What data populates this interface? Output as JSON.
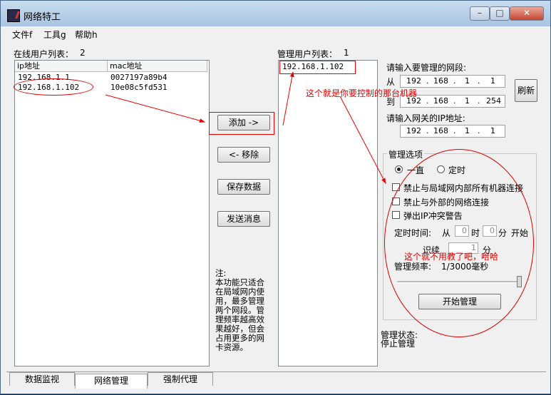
{
  "window": {
    "title": "网络特工"
  },
  "menu": [
    "文件f",
    "工具g",
    "帮助h"
  ],
  "online": {
    "label": "在线用户列表：",
    "count": "2",
    "columns": [
      "ip地址",
      "mac地址"
    ],
    "rows": [
      {
        "ip": "192.168.1.1",
        "mac": "0027197a89b4"
      },
      {
        "ip": "192.168.1.102",
        "mac": "10e08c5fd531"
      }
    ]
  },
  "buttons": {
    "add": "添加 ->",
    "remove": "<- 移除",
    "save": "保存数据",
    "send": "发送消息",
    "refresh": "刷新",
    "start": "开始管理"
  },
  "note": "注:\n本功能只适合在局域网内使用，最多管理两个网段。管理频率越高效果越好，但会占用更多的网卡资源。",
  "managed": {
    "label": "管理用户列表：",
    "count": "1",
    "items": [
      "192.168.1.102"
    ]
  },
  "segment": {
    "label": "请输入要管理的网段:",
    "from_label": "从",
    "to_label": "到",
    "from": [
      "192",
      "168",
      "1",
      "1"
    ],
    "to": [
      "192",
      "168",
      "1",
      "254"
    ]
  },
  "gateway": {
    "label": "请输入网关的IP地址:",
    "ip": [
      "192",
      "168",
      "1",
      "1"
    ]
  },
  "options": {
    "title": "管理选项",
    "always": "一直",
    "timed": "定时",
    "checks": [
      "禁止与局域网内部所有机器连接",
      "禁止与外部的网络连接",
      "弹出IP冲突警告"
    ],
    "time_label": "定时时间:",
    "from": "从",
    "hour_val": "0",
    "hour": "时",
    "min_val": "0",
    "minute": "分",
    "start_word": "开始",
    "last_label": "识续",
    "last_val": "1",
    "last_unit": "分",
    "freq_label": "管理频率:",
    "freq_val": "1/3000毫秒"
  },
  "status": {
    "label": "管理状态:",
    "value": "停止管理"
  },
  "annotations": {
    "a1": "这个就是你要控制的那台机器",
    "a2": "这个就不用教了吧，哈哈"
  },
  "tabs": [
    "数据监视",
    "网络管理",
    "强制代理"
  ]
}
